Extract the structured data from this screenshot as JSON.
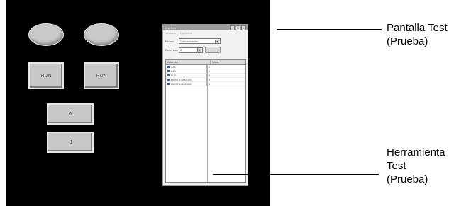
{
  "hmi": {
    "run_left": "RUN",
    "run_right": "RUN",
    "value_top": "0",
    "value_bottom": "-1"
  },
  "test_window": {
    "title": "Test Tool",
    "menu": [
      "Ventana",
      "Opciones"
    ],
    "status_label": "Estado",
    "status_value": "Comunicación",
    "columns_label": "Columnas",
    "columns_value": "2",
    "grid_headers": [
      "Address",
      "Value"
    ],
    "rows": [
      {
        "address": "$00",
        "value": "0"
      },
      {
        "address": "$10",
        "value": "0"
      },
      {
        "address": "$U0",
        "value": "0"
      },
      {
        "address": "HOST1:D00105",
        "value": "0"
      },
      {
        "address": "HOST1:D00006",
        "value": "0"
      }
    ]
  },
  "callouts": {
    "screen_line1": "Pantalla Test",
    "screen_line2": "(Prueba)",
    "tool_line1": "Herramienta",
    "tool_line2": "Test",
    "tool_line3": "(Prueba)"
  }
}
